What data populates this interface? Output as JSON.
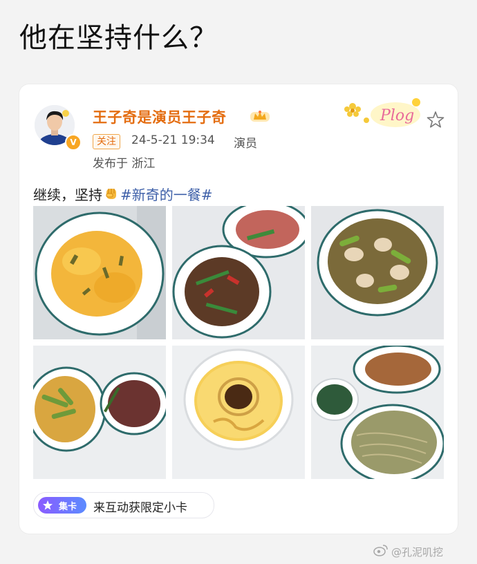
{
  "page": {
    "title": "他在坚持什么？"
  },
  "post": {
    "author": {
      "name": "王子奇是演员王子奇",
      "verified_icon": "verified-v-badge",
      "vip_icon": "crown-icon"
    },
    "follow_label": "关注",
    "time": "24-5-21 19:34",
    "source": "演员",
    "location": "发布于 浙江",
    "decoration_text": "Plog",
    "text_prefix": "继续，坚持",
    "hashtag": "#新奇的一餐#",
    "photos": [
      {
        "dish": "scrambled-eggs-with-chives"
      },
      {
        "dish": "stir-fried-beef-with-peppers-and-bacon"
      },
      {
        "dish": "mushroom-and-cucumber-stir-fry"
      },
      {
        "dish": "cucumber-egg-and-beef-plates"
      },
      {
        "dish": "steamed-egg-custard"
      },
      {
        "dish": "noodles-with-greens-and-stir-fry"
      }
    ],
    "card_chip": {
      "badge": "集卡",
      "text": "来互动获限定小卡"
    }
  },
  "watermark": {
    "text": "@孔泥叽挖",
    "icon": "weibo-icon"
  },
  "colors": {
    "username": "#e46d11",
    "hashtag": "#3d5fa8",
    "badge_gradient_start": "#8a5bff",
    "badge_gradient_end": "#5b8bff"
  }
}
